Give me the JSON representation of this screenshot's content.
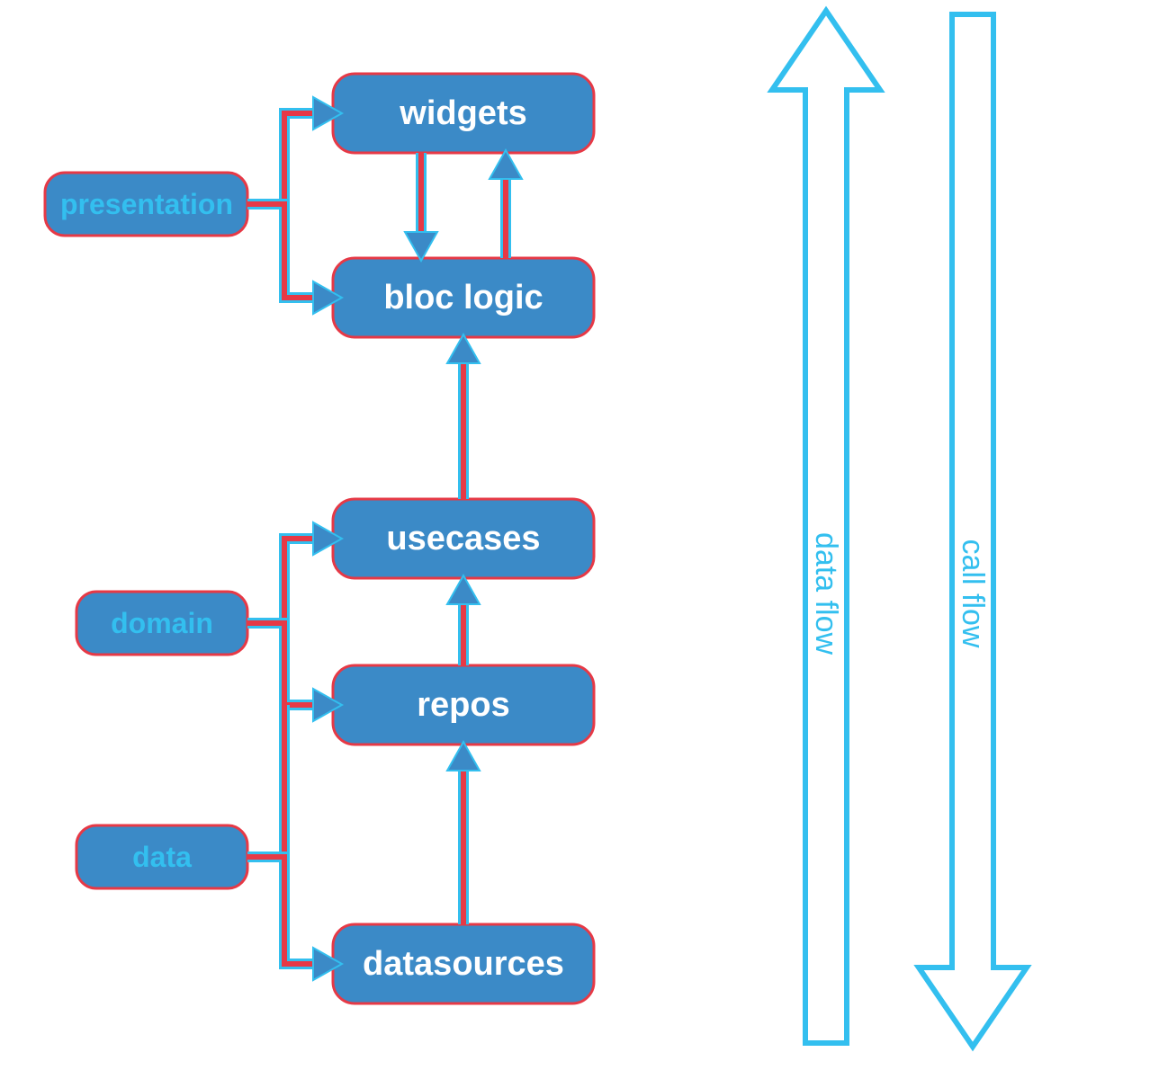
{
  "colors": {
    "box_fill": "#3b8ac7",
    "outline": "#e63946",
    "accent_light": "#33bfef",
    "text_light": "#ffffff"
  },
  "categories": {
    "presentation": {
      "label": "presentation"
    },
    "domain": {
      "label": "domain"
    },
    "data": {
      "label": "data"
    }
  },
  "layers": {
    "widgets": {
      "label": "widgets"
    },
    "bloc_logic": {
      "label": "bloc logic"
    },
    "usecases": {
      "label": "usecases"
    },
    "repos": {
      "label": "repos"
    },
    "datasources": {
      "label": "datasources"
    }
  },
  "flows": {
    "data_flow": "data flow",
    "call_flow": "call flow"
  },
  "diagram": {
    "description": "Clean architecture layer diagram: left column category boxes (presentation, domain, data) with bracket connectors to layer boxes (widgets, bloc logic, usecases, repos, datasources). Vertical arrows between layer boxes. Two large vertical arrows on the right labelled 'data flow' (pointing up) and 'call flow' (pointing down)."
  }
}
